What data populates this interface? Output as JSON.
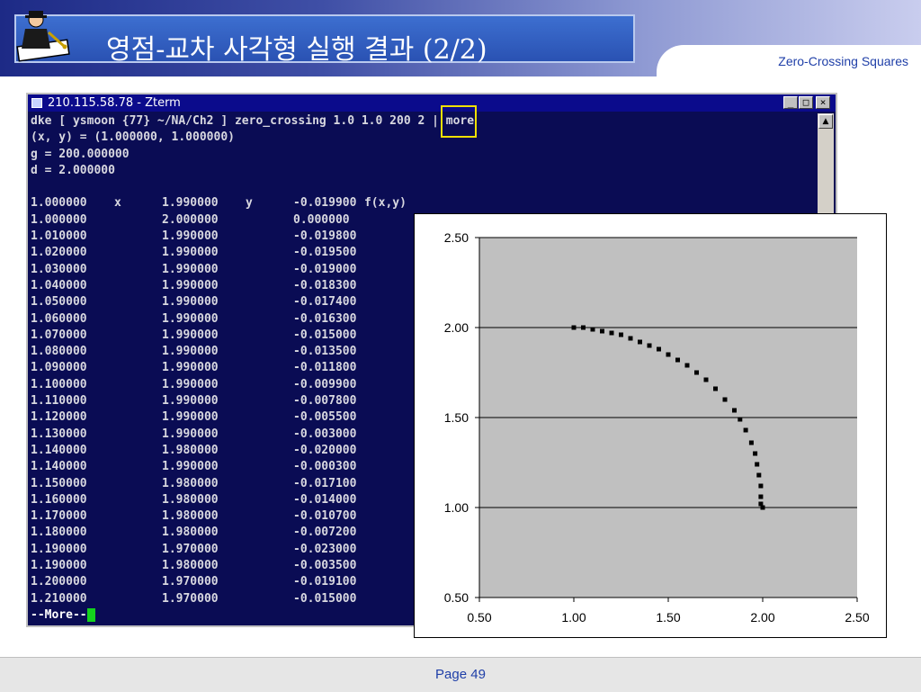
{
  "slide": {
    "title": "영점-교차 사각형 실행 결과 (2/2)",
    "subtitle": "Zero-Crossing Squares",
    "page": "Page 49"
  },
  "terminal": {
    "title": "210.115.58.78 - Zterm",
    "buttons": [
      "_",
      "□",
      "×"
    ],
    "lines": [
      "dke [ ysmoon {77} ~/NA/Ch2 ] zero_crossing 1.0 1.0 200 2 | more",
      "(x, y) = (1.000000, 1.000000)",
      "g = 200.000000",
      "d = 2.000000"
    ],
    "columns": [
      "x",
      "y",
      "f(x,y)"
    ],
    "rows": [
      [
        "1.000000",
        "1.990000",
        "-0.019900"
      ],
      [
        "1.000000",
        "2.000000",
        "0.000000"
      ],
      [
        "1.010000",
        "1.990000",
        "-0.019800"
      ],
      [
        "1.020000",
        "1.990000",
        "-0.019500"
      ],
      [
        "1.030000",
        "1.990000",
        "-0.019000"
      ],
      [
        "1.040000",
        "1.990000",
        "-0.018300"
      ],
      [
        "1.050000",
        "1.990000",
        "-0.017400"
      ],
      [
        "1.060000",
        "1.990000",
        "-0.016300"
      ],
      [
        "1.070000",
        "1.990000",
        "-0.015000"
      ],
      [
        "1.080000",
        "1.990000",
        "-0.013500"
      ],
      [
        "1.090000",
        "1.990000",
        "-0.011800"
      ],
      [
        "1.100000",
        "1.990000",
        "-0.009900"
      ],
      [
        "1.110000",
        "1.990000",
        "-0.007800"
      ],
      [
        "1.120000",
        "1.990000",
        "-0.005500"
      ],
      [
        "1.130000",
        "1.990000",
        "-0.003000"
      ],
      [
        "1.140000",
        "1.980000",
        "-0.020000"
      ],
      [
        "1.140000",
        "1.990000",
        "-0.000300"
      ],
      [
        "1.150000",
        "1.980000",
        "-0.017100"
      ],
      [
        "1.160000",
        "1.980000",
        "-0.014000"
      ],
      [
        "1.170000",
        "1.980000",
        "-0.010700"
      ],
      [
        "1.180000",
        "1.980000",
        "-0.007200"
      ],
      [
        "1.190000",
        "1.970000",
        "-0.023000"
      ],
      [
        "1.190000",
        "1.980000",
        "-0.003500"
      ],
      [
        "1.200000",
        "1.970000",
        "-0.019100"
      ],
      [
        "1.210000",
        "1.970000",
        "-0.015000"
      ]
    ],
    "prompt": "--More--",
    "highlight_text": "200"
  },
  "chart_data": {
    "type": "scatter",
    "xlim": [
      0.5,
      2.5
    ],
    "ylim": [
      0.5,
      2.5
    ],
    "x_ticks": [
      "0.50",
      "1.00",
      "1.50",
      "2.00",
      "2.50"
    ],
    "y_ticks": [
      "0.50",
      "1.00",
      "1.50",
      "2.00",
      "2.50"
    ],
    "grid": "horizontal",
    "background": "#c0c0c0",
    "marker_color": "#000000",
    "series": [
      {
        "x": [
          1.0,
          1.0,
          1.05,
          1.1,
          1.15,
          1.2,
          1.25,
          1.3,
          1.35,
          1.4,
          1.45,
          1.5,
          1.55,
          1.6,
          1.65,
          1.7,
          1.75,
          1.8,
          1.85,
          1.88,
          1.91,
          1.94,
          1.96,
          1.97,
          1.98,
          1.99,
          1.99,
          1.99,
          2.0
        ],
        "y": [
          2.0,
          2.0,
          2.0,
          1.99,
          1.98,
          1.97,
          1.96,
          1.94,
          1.92,
          1.9,
          1.88,
          1.85,
          1.82,
          1.79,
          1.75,
          1.71,
          1.66,
          1.6,
          1.54,
          1.49,
          1.43,
          1.36,
          1.3,
          1.24,
          1.18,
          1.12,
          1.06,
          1.02,
          1.0
        ]
      }
    ]
  }
}
